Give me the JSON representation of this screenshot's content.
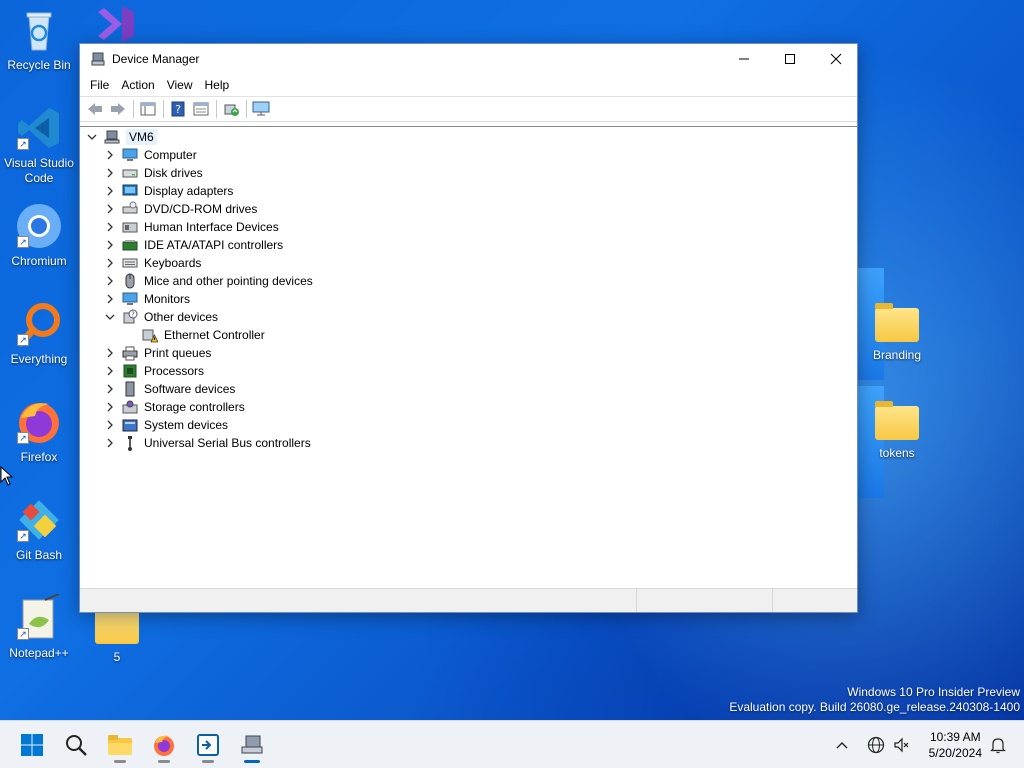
{
  "desktop": {
    "icons_left": [
      {
        "label": "Recycle Bin"
      },
      {
        "label": "Visual Studio Code"
      },
      {
        "label": "Chromium"
      },
      {
        "label": "Everything"
      },
      {
        "label": "Firefox"
      },
      {
        "label": "Git Bash"
      },
      {
        "label": "Notepad++"
      }
    ],
    "icon_folder_5": {
      "label": "5"
    },
    "icons_right": [
      {
        "label": "Branding"
      },
      {
        "label": "tokens"
      }
    ],
    "watermark": {
      "line1": "Windows 10 Pro Insider Preview",
      "line2": "Evaluation copy. Build 26080.ge_release.240308-1400"
    }
  },
  "window": {
    "title": "Device Manager",
    "menu": [
      "File",
      "Action",
      "View",
      "Help"
    ],
    "tree": {
      "root": "VM6",
      "categories": [
        {
          "label": "Computer",
          "icon": "computer-icon",
          "expanded": false
        },
        {
          "label": "Disk drives",
          "icon": "disk-drive-icon",
          "expanded": false
        },
        {
          "label": "Display adapters",
          "icon": "display-adapter-icon",
          "expanded": false
        },
        {
          "label": "DVD/CD-ROM drives",
          "icon": "dvd-drive-icon",
          "expanded": false
        },
        {
          "label": "Human Interface Devices",
          "icon": "hid-icon",
          "expanded": false
        },
        {
          "label": "IDE ATA/ATAPI controllers",
          "icon": "ide-controller-icon",
          "expanded": false
        },
        {
          "label": "Keyboards",
          "icon": "keyboard-icon",
          "expanded": false
        },
        {
          "label": "Mice and other pointing devices",
          "icon": "mouse-icon",
          "expanded": false
        },
        {
          "label": "Monitors",
          "icon": "monitor-icon",
          "expanded": false
        },
        {
          "label": "Other devices",
          "icon": "unknown-device-icon",
          "expanded": true,
          "children": [
            {
              "label": "Ethernet Controller",
              "icon": "warning-device-icon"
            }
          ]
        },
        {
          "label": "Print queues",
          "icon": "printer-icon",
          "expanded": false
        },
        {
          "label": "Processors",
          "icon": "processor-icon",
          "expanded": false
        },
        {
          "label": "Software devices",
          "icon": "software-device-icon",
          "expanded": false
        },
        {
          "label": "Storage controllers",
          "icon": "storage-controller-icon",
          "expanded": false
        },
        {
          "label": "System devices",
          "icon": "system-device-icon",
          "expanded": false
        },
        {
          "label": "Universal Serial Bus controllers",
          "icon": "usb-icon",
          "expanded": false
        }
      ]
    }
  },
  "taskbar": {
    "clock": {
      "time": "10:39 AM",
      "date": "5/20/2024"
    }
  },
  "colors": {
    "accent": "#0067c0",
    "desktop_blue": "#0a5fd6",
    "selection": "#e5f1fb"
  }
}
